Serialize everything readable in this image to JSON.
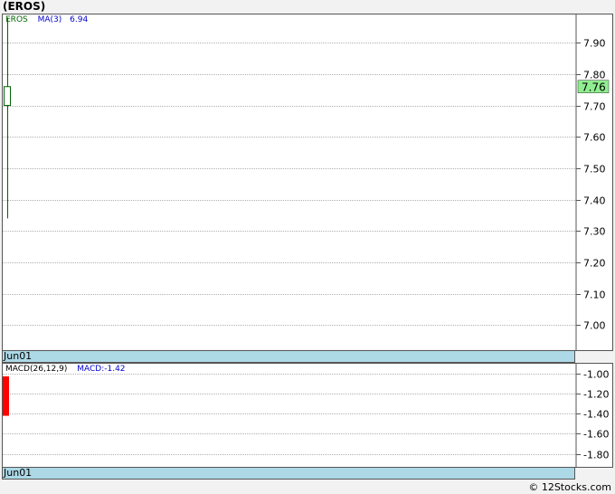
{
  "title": "(EROS)",
  "footer": "© 12Stocks.com",
  "colors": {
    "grid": "#b0b0b0",
    "candle": "#006400",
    "macd_bar": "#ff0000",
    "ma_label": "#0000cc",
    "price_tag": "#90ee90",
    "datebar": "#add8e6"
  },
  "chart_data": [
    {
      "type": "candlestick",
      "legend": {
        "symbol": "EROS",
        "ma_label": "MA(3)",
        "ma_value": "6.94"
      },
      "x": [
        "Jun01"
      ],
      "candles": [
        {
          "date": "Jun01",
          "open": 7.76,
          "close": 7.7,
          "high": 7.98,
          "low": 7.34
        }
      ],
      "last_price": "7.76",
      "ylim": [
        6.92,
        7.99
      ],
      "yticks": [
        "7.90",
        "7.80",
        "7.70",
        "7.60",
        "7.50",
        "7.40",
        "7.30",
        "7.20",
        "7.10",
        "7.00"
      ],
      "x_label": "Jun01",
      "grid": true
    },
    {
      "type": "bar",
      "legend": {
        "name": "MACD(26,12,9)",
        "value_label": "MACD:-1.42"
      },
      "x": [
        "Jun01"
      ],
      "values": [
        -1.42
      ],
      "ylim": [
        -1.93,
        -0.9
      ],
      "yticks": [
        "-1.00",
        "-1.20",
        "-1.40",
        "-1.60",
        "-1.80"
      ],
      "x_label": "Jun01",
      "grid": true
    }
  ]
}
